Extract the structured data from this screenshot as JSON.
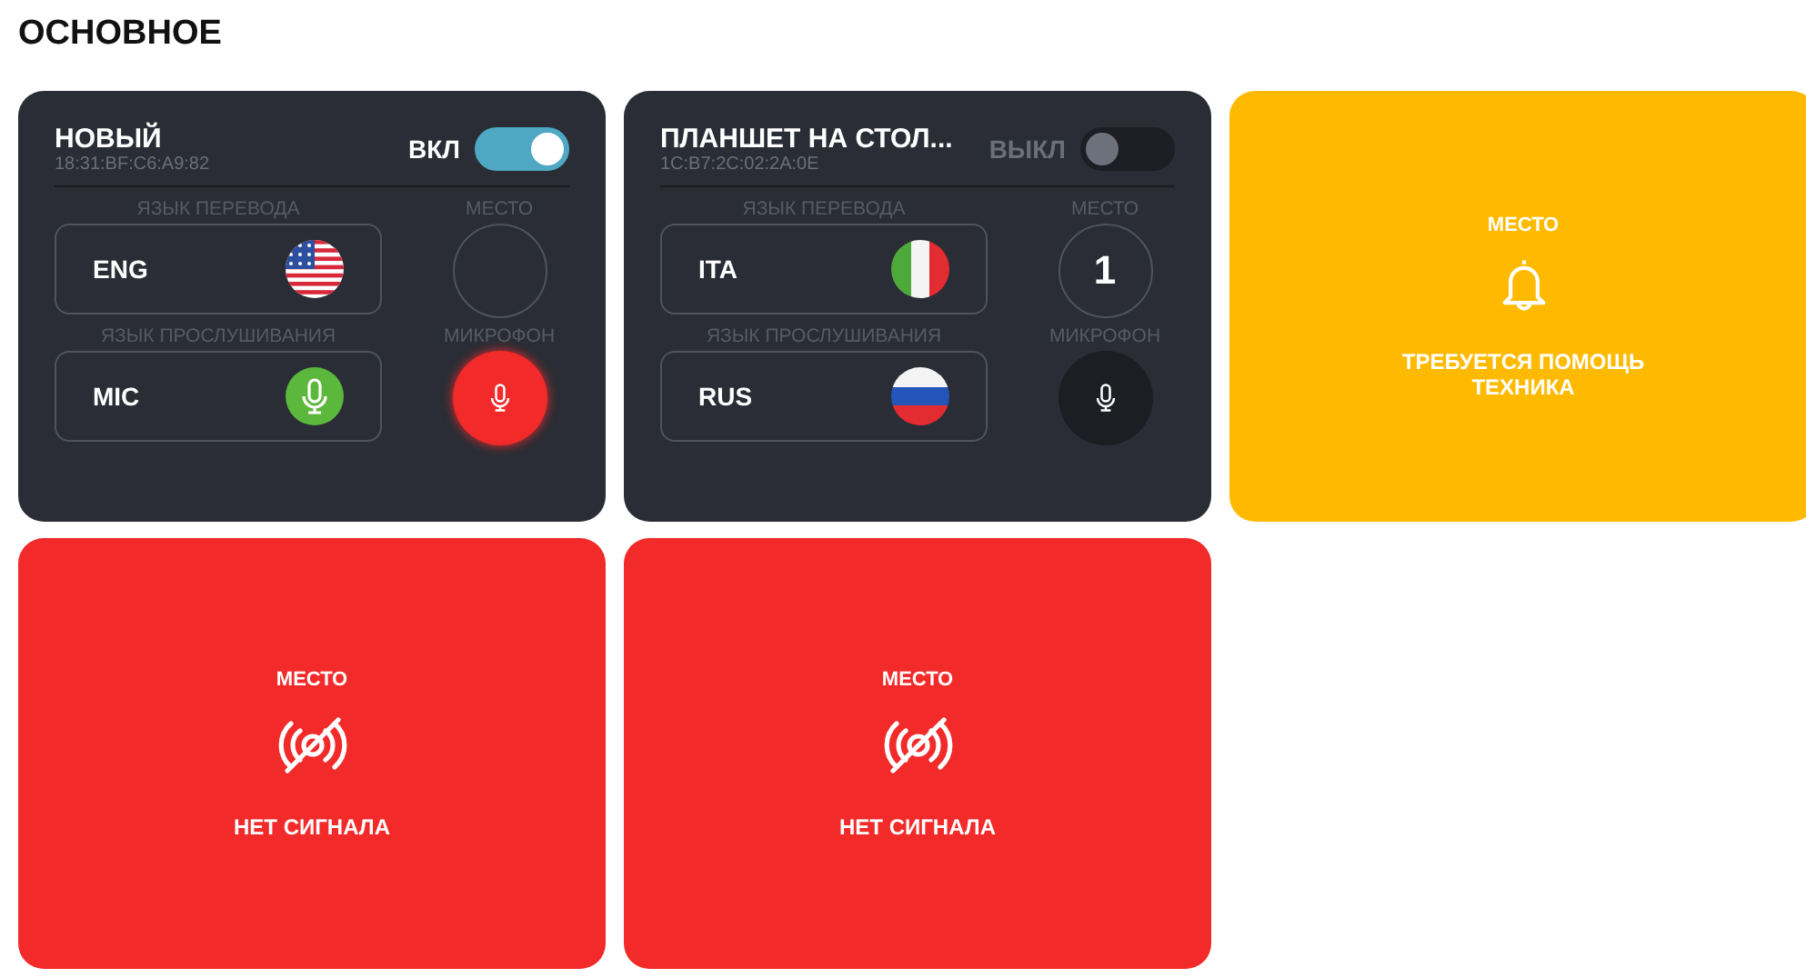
{
  "heading": "ОСНОВНОЕ",
  "tiles": [
    {
      "kind": "device",
      "name": "НОВЫЙ",
      "mac": "18:31:BF:C6:A9:82",
      "toggle_label": "ВКЛ",
      "on": true,
      "translate_label": "ЯЗЫК ПЕРЕВОДА",
      "translate_value": "ENG",
      "translate_badge": {
        "kind": "us"
      },
      "place_label": "МЕСТО",
      "listen_label": "ЯЗЫК ПРОСЛУШИВАНИЯ",
      "listen_value": "MIC",
      "listen_badge": {
        "kind": "mic"
      },
      "mic_label": "МИКРОФОН",
      "mic_active": true
    },
    {
      "kind": "device",
      "name": "ПЛАНШЕТ НА СТОЛ...",
      "mac": "1C:B7:2C:02:2A:0E",
      "toggle_label": "ВЫКЛ",
      "on": false,
      "translate_label": "ЯЗЫК ПЕРЕВОДА",
      "translate_value": "ITA",
      "translate_badge": {
        "kind": "it"
      },
      "place_label": "МЕСТО",
      "place_value": "1",
      "listen_label": "ЯЗЫК ПРОСЛУШИВАНИЯ",
      "listen_value": "RUS",
      "listen_badge": {
        "kind": "ru"
      },
      "mic_label": "МИКРОФОН",
      "mic_active": false
    },
    {
      "kind": "alert",
      "place_label": "МЕСТО",
      "message": "ТРЕБУЕТСЯ ПОМОЩЬ ТЕХНИКА"
    },
    {
      "kind": "no_signal",
      "place_label": "МЕСТО",
      "message": "НЕТ СИГНАЛА"
    },
    {
      "kind": "no_signal",
      "place_label": "МЕСТО",
      "message": "НЕТ СИГНАЛА"
    }
  ]
}
